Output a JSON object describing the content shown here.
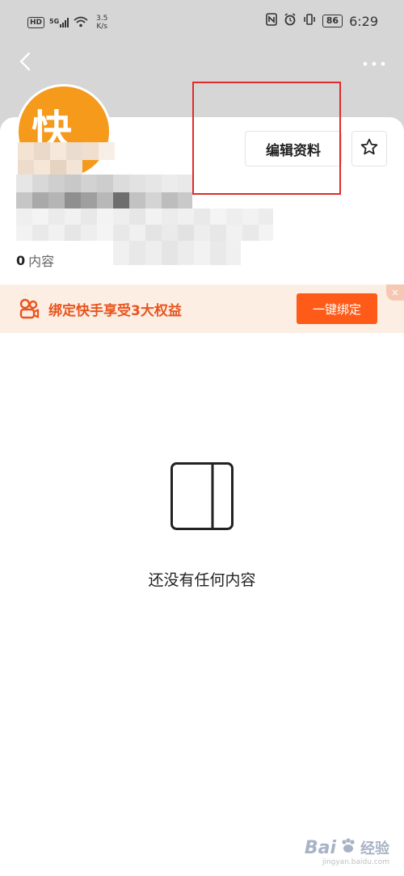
{
  "status_bar": {
    "hd_label": "HD",
    "network_label": "5G",
    "speed_value": "3.5",
    "speed_unit": "K/s",
    "battery": "86",
    "time": "6:29"
  },
  "profile": {
    "avatar_glyph": "快",
    "edit_button_label": "编辑资料",
    "stats": {
      "content_count": "0",
      "content_label": "内容"
    }
  },
  "banner": {
    "text": "绑定快手享受3大权益",
    "button_label": "一键绑定",
    "close_label": "×"
  },
  "empty_state": {
    "message": "还没有任何内容"
  },
  "watermark": {
    "brand": "Bai",
    "suffix": "经验",
    "site": "jingyan.baidu.com"
  },
  "colors": {
    "accent": "#fe5b19",
    "banner_bg": "#fdeee4",
    "banner_text": "#e8541e",
    "avatar_bg": "#f59a1b",
    "highlight": "#e22a2a"
  }
}
